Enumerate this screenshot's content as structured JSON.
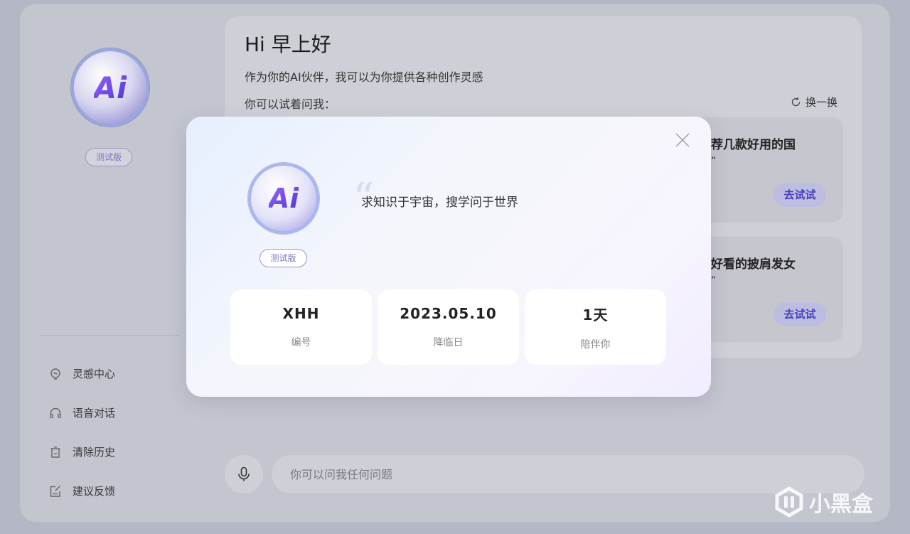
{
  "app": {
    "sidebar": {
      "logo_text": "Ai",
      "badge": "测试版",
      "menu": [
        {
          "label": "灵感中心",
          "icon": "bulb-icon"
        },
        {
          "label": "语音对话",
          "icon": "headphones-icon"
        },
        {
          "label": "清除历史",
          "icon": "trash-icon"
        },
        {
          "label": "建议反馈",
          "icon": "feedback-icon"
        }
      ]
    },
    "main": {
      "greeting": "Hi 早上好",
      "subtitle": "作为你的AI伙伴，我可以为你提供各种创作灵感",
      "try_label": "你可以试着问我：",
      "refresh_label": "换一换",
      "suggestions": [
        {
          "text": "荐几款好用的国",
          "quote": "”",
          "button": "去试试"
        },
        {
          "text": "好看的披肩发女",
          "quote": "”",
          "button": "去试试"
        }
      ],
      "input_placeholder": "你可以问我任何问题"
    },
    "watermark": "小黑盒"
  },
  "modal": {
    "logo_text": "Ai",
    "badge": "测试版",
    "motto": "求知识于宇宙，搜学问于世界",
    "stats": [
      {
        "value": "XHH",
        "label": "编号"
      },
      {
        "value": "2023.05.10",
        "label": "降临日"
      },
      {
        "value": "1天",
        "label": "陪伴你"
      }
    ],
    "close_symbol": "✕"
  }
}
